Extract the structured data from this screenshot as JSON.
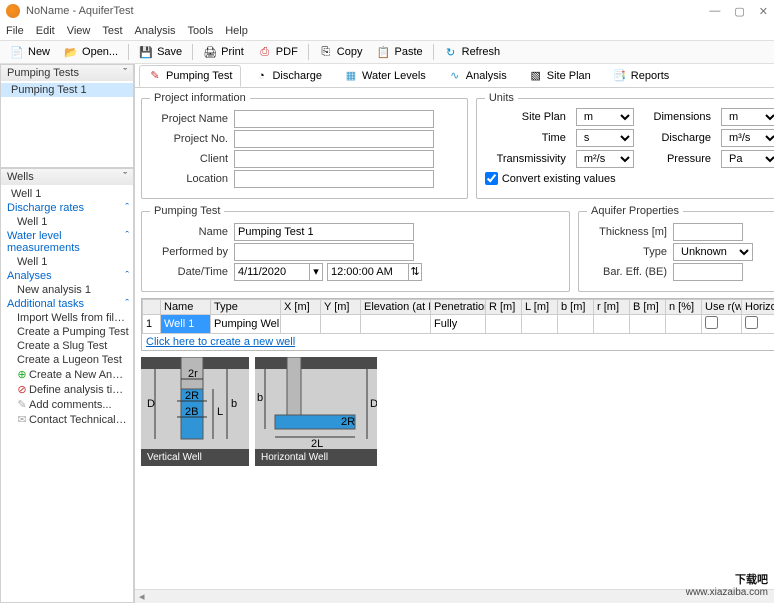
{
  "window": {
    "title": "NoName - AquiferTest"
  },
  "menu": [
    "File",
    "Edit",
    "View",
    "Test",
    "Analysis",
    "Tools",
    "Help"
  ],
  "toolbar": {
    "new": "New",
    "open": "Open...",
    "save": "Save",
    "print": "Print",
    "pdf": "PDF",
    "copy": "Copy",
    "paste": "Paste",
    "refresh": "Refresh"
  },
  "sidebar": {
    "panels": {
      "top": {
        "title": "Pumping Tests",
        "items": [
          "Pumping Test 1"
        ]
      },
      "bottom": {
        "title": "Wells",
        "well_root": "Well 1",
        "discharge_hdr": "Discharge rates",
        "discharge_item": "Well 1",
        "waterlevel_hdr": "Water level measurements",
        "waterlevel_item": "Well 1",
        "analyses_hdr": "Analyses",
        "analyses_item": "New analysis 1",
        "addl_hdr": "Additional tasks",
        "tasks": [
          "Import Wells from file...",
          "Create a Pumping Test",
          "Create a Slug Test",
          "Create a Lugeon Test",
          "Create a New Analysis",
          "Define analysis time range...",
          "Add comments...",
          "Contact Technical Support..."
        ]
      }
    }
  },
  "tabs": [
    "Pumping Test",
    "Discharge",
    "Water Levels",
    "Analysis",
    "Site Plan",
    "Reports"
  ],
  "project_info": {
    "legend": "Project information",
    "labels": {
      "name": "Project Name",
      "no": "Project No.",
      "client": "Client",
      "location": "Location"
    },
    "values": {
      "name": "",
      "no": "",
      "client": "",
      "location": ""
    }
  },
  "units": {
    "legend": "Units",
    "site_plan": {
      "label": "Site Plan",
      "value": "m"
    },
    "dimensions": {
      "label": "Dimensions",
      "value": "m"
    },
    "time": {
      "label": "Time",
      "value": "s"
    },
    "discharge": {
      "label": "Discharge",
      "value": "m³/s"
    },
    "transmissivity": {
      "label": "Transmissivity",
      "value": "m²/s"
    },
    "pressure": {
      "label": "Pressure",
      "value": "Pa"
    },
    "convert": "Convert existing values"
  },
  "pumping_test": {
    "legend": "Pumping Test",
    "labels": {
      "name": "Name",
      "performed": "Performed by",
      "datetime": "Date/Time"
    },
    "values": {
      "name": "Pumping Test 1",
      "performed": "",
      "date": "4/11/2020",
      "time": "12:00:00 AM"
    }
  },
  "aquifer": {
    "legend": "Aquifer Properties",
    "labels": {
      "thickness": "Thickness [m]",
      "type": "Type",
      "bareff": "Bar. Eff. (BE)"
    },
    "values": {
      "thickness": "",
      "type": "Unknown",
      "bareff": ""
    }
  },
  "grid": {
    "headers": [
      "",
      "Name",
      "Type",
      "X [m]",
      "Y [m]",
      "Elevation (at Benchmark)",
      "Penetration",
      "R [m]",
      "L [m]",
      "b [m]",
      "r [m]",
      "B [m]",
      "n [%]",
      "Use r(w)",
      "Horizontal"
    ],
    "row": {
      "idx": "1",
      "name": "Well 1",
      "type": "Pumping Well",
      "x": "",
      "y": "",
      "elev": "",
      "pen": "Fully",
      "R": "",
      "L": "",
      "b": "",
      "r": "",
      "B": "",
      "n": "",
      "use": "",
      "horiz": ""
    },
    "link": "Click here to create a new well"
  },
  "diagrams": {
    "vertical": "Vertical Well",
    "horizontal": "Horizontal Well",
    "labels": {
      "D": "D",
      "b": "b",
      "L": "L",
      "r2": "2r",
      "R2": "2R",
      "B2": "2B",
      "L2": "2L"
    }
  },
  "watermark": {
    "big": "下载吧",
    "url": "www.xiazaiba.com"
  }
}
